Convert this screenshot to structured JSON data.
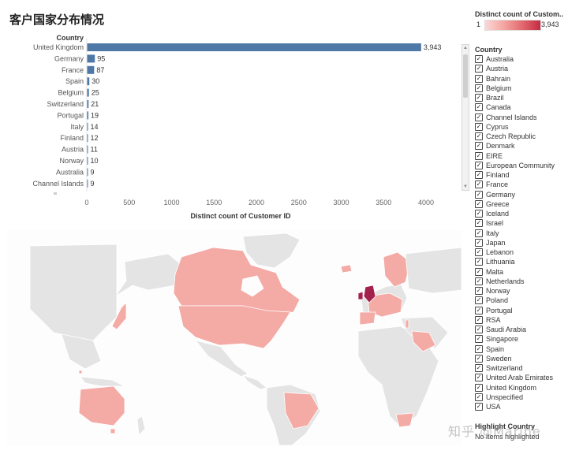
{
  "page_title": "客户国家分布情况",
  "chart_data": {
    "type": "bar",
    "orientation": "horizontal",
    "dimension_label": "Country",
    "xlabel": "Distinct count of Customer ID",
    "xlim": [
      0,
      4000
    ],
    "xticks": [
      0,
      500,
      1000,
      1500,
      2000,
      2500,
      3000,
      3500,
      4000
    ],
    "categories": [
      "United Kingdom",
      "Germany",
      "France",
      "Spain",
      "Belgium",
      "Switzerland",
      "Portugal",
      "Italy",
      "Finland",
      "Austria",
      "Norway",
      "Australia",
      "Channel Islands"
    ],
    "values": [
      3943,
      95,
      87,
      30,
      25,
      21,
      19,
      14,
      12,
      11,
      10,
      9,
      9
    ],
    "value_labels": [
      "3,943",
      "95",
      "87",
      "30",
      "25",
      "21",
      "19",
      "14",
      "12",
      "11",
      "10",
      "9",
      "9"
    ],
    "bar_color": "#4e79a7",
    "grid": false
  },
  "map": {
    "land_color": "#e4e4e4",
    "highlight_color": "#f4aaa5",
    "max_color": "#a3214b"
  },
  "color_legend": {
    "title": "Distinct count of Custom..",
    "min_label": "1",
    "max_label": "3,943",
    "min_color": "#fbd8d6",
    "max_color": "#c42b43"
  },
  "country_filter": {
    "title": "Country",
    "items": [
      "Australia",
      "Austria",
      "Bahrain",
      "Belgium",
      "Brazil",
      "Canada",
      "Channel Islands",
      "Cyprus",
      "Czech Republic",
      "Denmark",
      "EIRE",
      "European Community",
      "Finland",
      "France",
      "Germany",
      "Greece",
      "Iceland",
      "Israel",
      "Italy",
      "Japan",
      "Lebanon",
      "Lithuania",
      "Malta",
      "Netherlands",
      "Norway",
      "Poland",
      "Portugal",
      "RSA",
      "Saudi Arabia",
      "Singapore",
      "Spain",
      "Sweden",
      "Switzerland",
      "United Arab Emirates",
      "United Kingdom",
      "Unspecified",
      "USA"
    ]
  },
  "highlight": {
    "title": "Highlight Country",
    "empty_text": "No items highlighted"
  },
  "watermark": "知乎 @Marine"
}
